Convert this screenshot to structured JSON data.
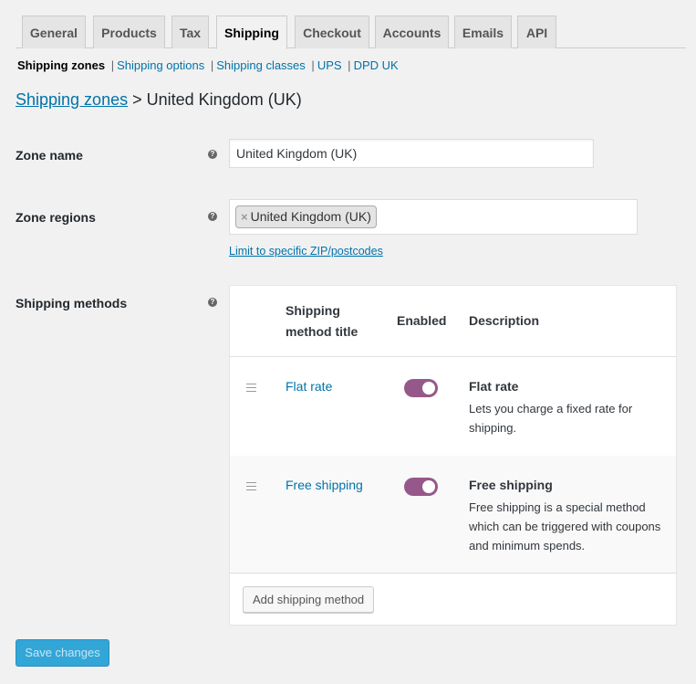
{
  "tabs": [
    "General",
    "Products",
    "Tax",
    "Shipping",
    "Checkout",
    "Accounts",
    "Emails",
    "API"
  ],
  "active_tab": "Shipping",
  "subnav": {
    "current": "Shipping zones",
    "links": [
      "Shipping options",
      "Shipping classes",
      "UPS",
      "DPD UK"
    ],
    "separator": "|"
  },
  "heading": {
    "link": "Shipping zones",
    "arrow": ">",
    "title": "United Kingdom (UK)"
  },
  "zone_name": {
    "label": "Zone name",
    "value": "United Kingdom (UK)"
  },
  "zone_regions": {
    "label": "Zone regions",
    "chip_remove": "×",
    "chip": "United Kingdom (UK)",
    "limit_link": "Limit to specific ZIP/postcodes"
  },
  "help_icon": "?",
  "methods": {
    "label": "Shipping methods",
    "headers": {
      "title_line1": "Shipping",
      "title_line2": "method title",
      "enabled": "Enabled",
      "description": "Description"
    },
    "rows": [
      {
        "title": "Flat rate",
        "enabled": true,
        "desc_title": "Flat rate",
        "desc_text": "Lets you charge a fixed rate for shipping."
      },
      {
        "title": "Free shipping",
        "enabled": true,
        "desc_title": "Free shipping",
        "desc_text": "Free shipping is a special method which can be triggered with coupons and minimum spends."
      }
    ],
    "add_button": "Add shipping method"
  },
  "save_button": "Save changes",
  "colors": {
    "toggle_on": "#96588a",
    "link": "#0073aa",
    "primary_button": "#33a6d8"
  }
}
